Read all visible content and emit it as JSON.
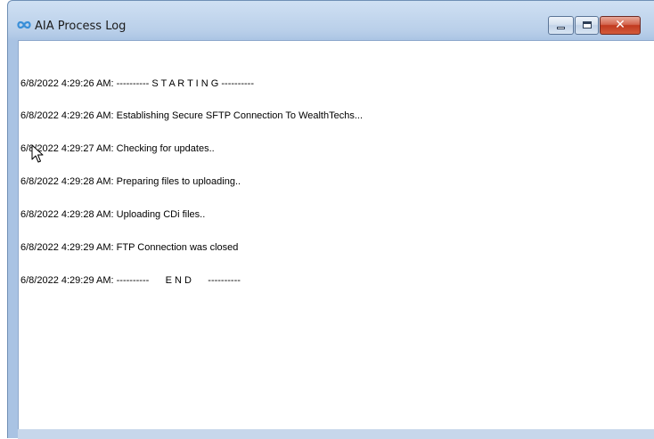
{
  "window": {
    "title": "AIA Process Log",
    "icon": "infinity-icon",
    "accent": "#3a8fd8",
    "controls": [
      "minimize",
      "maximize",
      "close"
    ],
    "close_glyph": "✕"
  },
  "log": {
    "lines": [
      "6/8/2022 4:29:26 AM: ---------- S T A R T I N G ----------",
      "6/8/2022 4:29:26 AM: Establishing Secure SFTP Connection To WealthTechs...",
      "6/8/2022 4:29:27 AM: Checking for updates..",
      "6/8/2022 4:29:28 AM: Preparing files to uploading..",
      "6/8/2022 4:29:28 AM: Uploading CDi files..",
      "6/8/2022 4:29:29 AM: FTP Connection was closed",
      "6/8/2022 4:29:29 AM: ----------      E N D      ----------"
    ]
  }
}
